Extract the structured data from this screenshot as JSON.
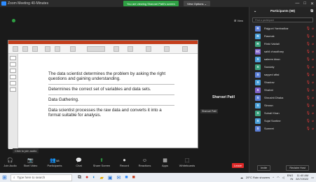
{
  "window": {
    "title": "Zoom Meeting 40-Minutes",
    "share_banner": "You are viewing Sharvari Patil's screen",
    "view_options": "View Options ⌄",
    "view_link": "⊞ View",
    "controls": [
      "—",
      "□",
      "✕"
    ]
  },
  "slide": {
    "points": [
      "The data scientist determines the problem by asking the right questions and gaining understanding.",
      "Determines the correct set of variables and data sets.",
      "Data Gathering.",
      "Data scientist processes the raw data and converts it into a format suitable for analysis."
    ]
  },
  "speaker": {
    "name": "Sharvari Patil",
    "tag": "Sharvari Patil"
  },
  "click_to_join_audio": "Click to join audio",
  "toolbar": {
    "items": [
      {
        "label": "Join Audio",
        "icon": "headphone-icon",
        "glyph": "🎧"
      },
      {
        "label": "Start Video",
        "icon": "video-off-icon",
        "glyph": "📷"
      },
      {
        "label": "Participants",
        "icon": "participants-icon",
        "glyph": "👥",
        "count": "58"
      },
      {
        "label": "Chat",
        "icon": "chat-icon",
        "glyph": "💬"
      },
      {
        "label": "Share Screen",
        "icon": "share-screen-icon",
        "glyph": "⬆"
      },
      {
        "label": "Record",
        "icon": "record-icon",
        "glyph": "⏺"
      },
      {
        "label": "Reactions",
        "icon": "reactions-icon",
        "glyph": "☺"
      },
      {
        "label": "Apps",
        "icon": "apps-icon",
        "glyph": "▦"
      },
      {
        "label": "Whiteboards",
        "icon": "whiteboard-icon",
        "glyph": "⬚"
      }
    ],
    "leave": "Leave"
  },
  "participants": {
    "title": "Participants (58)",
    "search_placeholder": "Find a participant",
    "list": [
      {
        "initial": "R",
        "name": "Rajguni Yambadkar",
        "color": "#5b7fd6"
      },
      {
        "initial": "R",
        "name": "Rasmak",
        "color": "#4a9fd8"
      },
      {
        "initial": "R",
        "name": "Rinki Vaidali",
        "color": "#3aa17e"
      },
      {
        "initial": "SC",
        "name": "sahil chaudhary",
        "color": "#7e62c9"
      },
      {
        "initial": "S",
        "name": "saleem khan",
        "color": "#4a9fd8"
      },
      {
        "initial": "S",
        "name": "Sandaly",
        "color": "#3aa17e"
      },
      {
        "initial": "S",
        "name": "sayyed aftal",
        "color": "#5b7fd6"
      },
      {
        "initial": "S",
        "name": "Shadow",
        "color": "#4a9fd8"
      },
      {
        "initial": "S",
        "name": "Shalvni",
        "color": "#7e62c9"
      },
      {
        "initial": "S",
        "name": "Shrushti Dhaka",
        "color": "#5b7fd6"
      },
      {
        "initial": "S",
        "name": "Simran",
        "color": "#4a9fd8"
      },
      {
        "initial": "S",
        "name": "Suhail Khan",
        "color": "#3aa17e"
      },
      {
        "initial": "S",
        "name": "Sujal Sontine",
        "color": "#4a9fd8"
      },
      {
        "initial": "S",
        "name": "Sumeet",
        "color": "#5b7fd6"
      }
    ],
    "invite": "Invite",
    "reclaim": "Reclaim Host"
  },
  "taskbar": {
    "search_placeholder": "Type here to search",
    "weather": "29°C Rain showers",
    "lang": "ENG\nIN",
    "time": "11:40 AM",
    "date": "8/17/2022"
  }
}
